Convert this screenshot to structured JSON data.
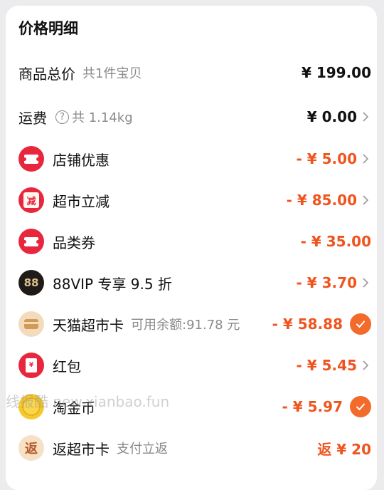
{
  "title": "价格明细",
  "rows": {
    "total": {
      "label": "商品总价",
      "sub": "共1件宝贝",
      "amount": "¥ 199.00"
    },
    "shipping": {
      "label": "运费",
      "help_glyph": "?",
      "sub": "共 1.14kg",
      "amount": "¥ 0.00"
    },
    "store_discount": {
      "label": "店铺优惠",
      "amount": "- ¥ 5.00"
    },
    "supermarket_discount": {
      "label": "超市立减",
      "icon_text": "减",
      "amount": "- ¥ 85.00"
    },
    "category_coupon": {
      "label": "品类券",
      "amount": "- ¥ 35.00"
    },
    "vip": {
      "label": "88VIP 专享 9.5 折",
      "icon_text": "88",
      "amount": "- ¥ 3.70"
    },
    "tmall_card": {
      "label": "天猫超市卡",
      "sub": "可用余额:91.78 元",
      "amount": "- ¥ 58.88",
      "checked": true
    },
    "red_packet": {
      "label": "红包",
      "icon_text": "¥",
      "amount": "- ¥ 5.45"
    },
    "taojinbi": {
      "label": "淘金币",
      "amount": "- ¥ 5.97",
      "checked": true
    },
    "rebate_card": {
      "label": "返超市卡",
      "icon_text": "返",
      "sub": "支付立返",
      "amount": "返 ¥ 20"
    }
  },
  "watermark": "线报酷 new.xianbao.fun",
  "colors": {
    "accent": "#f0541e",
    "icon_red": "#e8263d",
    "check": "#f26b2b"
  }
}
